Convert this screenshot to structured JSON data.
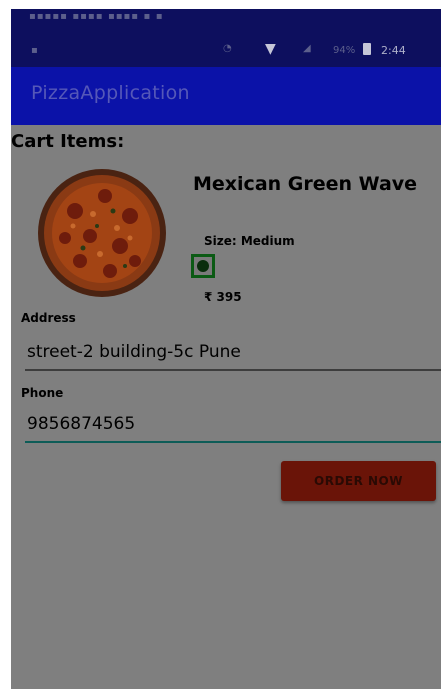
{
  "status_bar": {
    "notifications": "▪▪▪▪▪  ▪▪▪▪  ▪▪▪▪  ▪  ▪",
    "battery_percent": "94%",
    "time": "2:44"
  },
  "app_bar": {
    "title": "PizzaApplication"
  },
  "cart": {
    "title": "Cart Items:",
    "item": {
      "name": "Mexican Green Wave",
      "size": "Size: Medium",
      "price": "₹ 395",
      "veg_indicator_color": "#0b5a14"
    }
  },
  "form": {
    "address_label": "Address",
    "address_value": "street-2 building-5c Pune",
    "phone_label": "Phone",
    "phone_value": "9856874565"
  },
  "actions": {
    "order_button": "ORDER NOW"
  },
  "colors": {
    "app_bar": "#0b12a8",
    "status_bar": "#0d0f5e",
    "screen_background": "#7f7f7f",
    "order_button": "#6a1408",
    "phone_underline": "#0d5c57"
  }
}
